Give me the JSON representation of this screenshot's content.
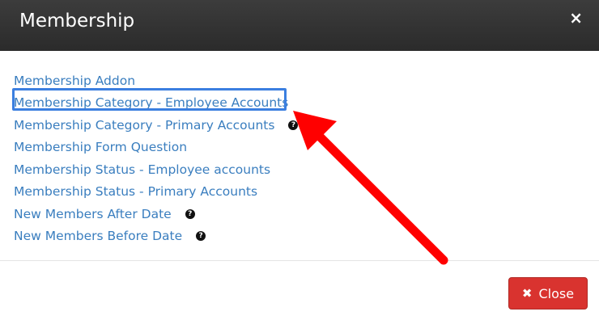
{
  "modal": {
    "title": "Membership",
    "close_icon": "×"
  },
  "links": [
    {
      "label": "Membership Addon",
      "help": false
    },
    {
      "label": "Membership Category - Employee Accounts",
      "help": false,
      "highlighted": true
    },
    {
      "label": "Membership Category - Primary Accounts",
      "help": true
    },
    {
      "label": "Membership Form Question",
      "help": false
    },
    {
      "label": "Membership Status - Employee accounts",
      "help": false
    },
    {
      "label": "Membership Status - Primary Accounts",
      "help": false
    },
    {
      "label": "New Members After Date",
      "help": true
    },
    {
      "label": "New Members Before Date",
      "help": true
    }
  ],
  "help_icon": "?",
  "footer": {
    "close_label": "Close",
    "close_icon": "✖"
  },
  "colors": {
    "header": "#2f2f2f",
    "link": "#3a7ebf",
    "highlight": "#3b7fe0",
    "arrow": "#ff0000",
    "close_button": "#d9332f"
  }
}
